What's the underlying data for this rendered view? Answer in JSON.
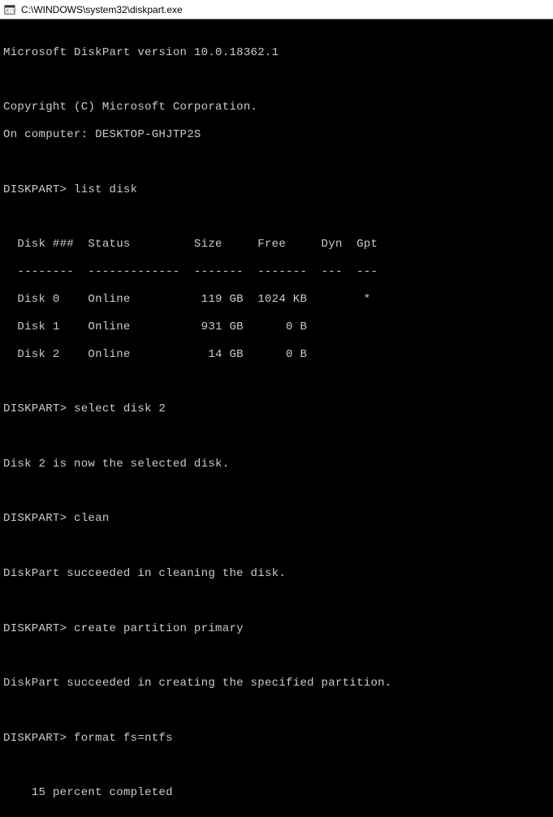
{
  "titlebar": {
    "path": "C:\\WINDOWS\\system32\\diskpart.exe"
  },
  "terminal": {
    "version_line": "Microsoft DiskPart version 10.0.18362.1",
    "copyright_line": "Copyright (C) Microsoft Corporation.",
    "computer_line": "On computer: DESKTOP-GHJTP2S",
    "prompt1": "DISKPART> list disk",
    "table_header": "  Disk ###  Status         Size     Free     Dyn  Gpt",
    "table_divider": "  --------  -------------  -------  -------  ---  ---",
    "disk0": "  Disk 0    Online          119 GB  1024 KB        *",
    "disk1": "  Disk 1    Online          931 GB      0 B",
    "disk2": "  Disk 2    Online           14 GB      0 B",
    "prompt2": "DISKPART> select disk 2",
    "selected_msg": "Disk 2 is now the selected disk.",
    "prompt3": "DISKPART> clean",
    "clean_msg": "DiskPart succeeded in cleaning the disk.",
    "prompt4": "DISKPART> create partition primary",
    "partition_msg": "DiskPart succeeded in creating the specified partition.",
    "prompt5": "DISKPART> format fs=ntfs",
    "progress_msg": "    15 percent completed"
  },
  "chart_data": {
    "type": "table",
    "title": "list disk",
    "columns": [
      "Disk ###",
      "Status",
      "Size",
      "Free",
      "Dyn",
      "Gpt"
    ],
    "rows": [
      {
        "disk": "Disk 0",
        "status": "Online",
        "size": "119 GB",
        "free": "1024 KB",
        "dyn": "",
        "gpt": "*"
      },
      {
        "disk": "Disk 1",
        "status": "Online",
        "size": "931 GB",
        "free": "0 B",
        "dyn": "",
        "gpt": ""
      },
      {
        "disk": "Disk 2",
        "status": "Online",
        "size": "14 GB",
        "free": "0 B",
        "dyn": "",
        "gpt": ""
      }
    ]
  }
}
